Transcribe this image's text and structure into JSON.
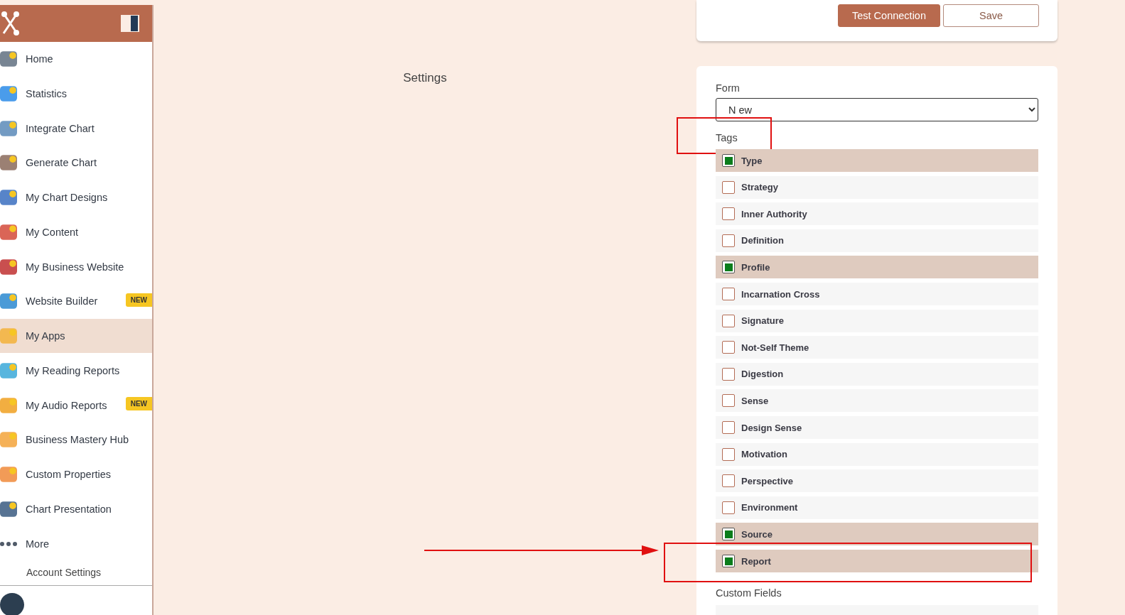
{
  "sidebar": {
    "items": [
      {
        "label": "Home",
        "selected": false
      },
      {
        "label": "Statistics",
        "selected": false
      },
      {
        "label": "Integrate Chart",
        "selected": false
      },
      {
        "label": "Generate Chart",
        "selected": false
      },
      {
        "label": "My Chart Designs",
        "selected": false
      },
      {
        "label": "My Content",
        "selected": false
      },
      {
        "label": "My Business Website",
        "selected": false
      },
      {
        "label": "Website Builder",
        "selected": false,
        "badge": "NEW"
      },
      {
        "label": "My Apps",
        "selected": true
      },
      {
        "label": "My Reading Reports",
        "selected": false
      },
      {
        "label": "My Audio Reports",
        "selected": false,
        "badge": "NEW"
      },
      {
        "label": "Business Mastery Hub",
        "selected": false
      },
      {
        "label": "Custom Properties",
        "selected": false
      },
      {
        "label": "Chart Presentation",
        "selected": false
      },
      {
        "label": "More",
        "selected": false
      }
    ],
    "account_link": "Account Settings"
  },
  "main": {
    "heading": "Settings",
    "actions": [
      {
        "label": "Test Connection",
        "kind": "primary"
      },
      {
        "label": "Save",
        "kind": "outline"
      }
    ],
    "form": {
      "label": "Form",
      "value": "N ew"
    },
    "tags": {
      "label": "Tags",
      "highlighted": true,
      "items": [
        {
          "label": "Type",
          "checked": true,
          "highlighted": false
        },
        {
          "label": "Strategy",
          "checked": false,
          "highlighted": false
        },
        {
          "label": "Inner Authority",
          "checked": false,
          "highlighted": false
        },
        {
          "label": "Definition",
          "checked": false,
          "highlighted": false
        },
        {
          "label": "Profile",
          "checked": true,
          "highlighted": false
        },
        {
          "label": "Incarnation Cross",
          "checked": false,
          "highlighted": false
        },
        {
          "label": "Signature",
          "checked": false,
          "highlighted": false
        },
        {
          "label": "Not-Self Theme",
          "checked": false,
          "highlighted": false
        },
        {
          "label": "Digestion",
          "checked": false,
          "highlighted": false
        },
        {
          "label": "Sense",
          "checked": false,
          "highlighted": false
        },
        {
          "label": "Design Sense",
          "checked": false,
          "highlighted": false
        },
        {
          "label": "Motivation",
          "checked": false,
          "highlighted": false
        },
        {
          "label": "Perspective",
          "checked": false,
          "highlighted": false
        },
        {
          "label": "Environment",
          "checked": false,
          "highlighted": false
        },
        {
          "label": "Source",
          "checked": true,
          "highlighted": false
        },
        {
          "label": "Report",
          "checked": true,
          "highlighted": true
        }
      ]
    },
    "custom_fields": {
      "label": "Custom Fields"
    }
  }
}
